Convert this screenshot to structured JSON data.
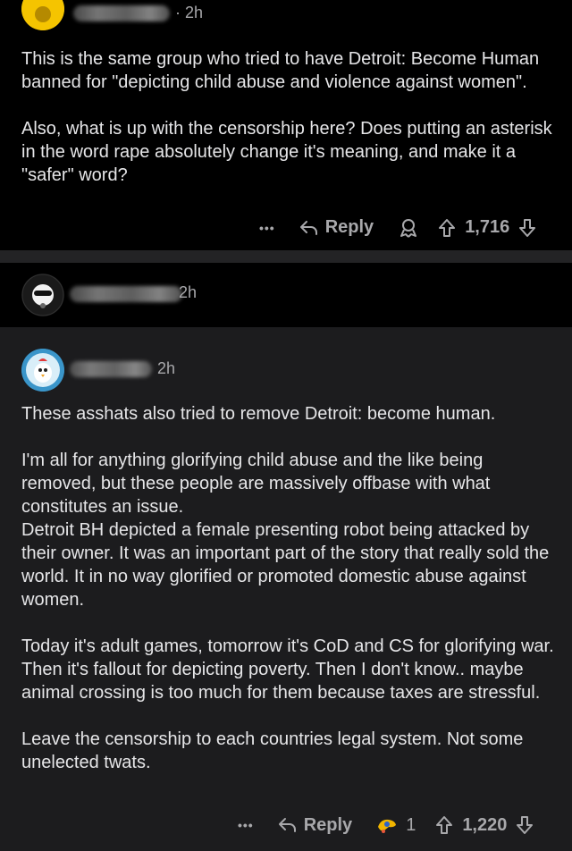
{
  "comments": [
    {
      "time": "· 2h",
      "paragraphs": [
        "This is the same group who tried to have Detroit: Become Human banned for \"depicting child abuse and violence against women\".",
        "Also, what is up with the censorship here? Does putting an asterisk in the word rape absolutely change it's meaning, and make it a \"safer\" word?"
      ],
      "more": "•••",
      "reply": "Reply",
      "votes": "1,716"
    },
    {
      "time": "2h"
    },
    {
      "time": "2h",
      "paragraphs": [
        "These asshats also tried to remove Detroit: become human.",
        "I'm all for anything glorifying child abuse and the like being removed, but these people are massively offbase with what constitutes an issue.\nDetroit BH depicted a female presenting robot being attacked by their owner. It was an important part of the story that really sold the world. It in no way glorified or promoted domestic abuse against women.",
        "Today it's adult games, tomorrow it's CoD and CS for glorifying war. Then it's fallout for depicting poverty. Then I don't know.. maybe animal crossing is too much for them because taxes are stressful.",
        "Leave the censorship to each countries legal system. Not some unelected twats."
      ],
      "more": "•••",
      "reply": "Reply",
      "award_count": "1",
      "votes": "1,220"
    }
  ],
  "colors": {
    "background": "#000000",
    "reply_bg": "#1c1c1e",
    "text": "#e6e6e8",
    "meta": "#a8a8ab"
  }
}
